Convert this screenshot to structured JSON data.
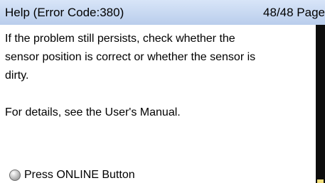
{
  "header": {
    "title": "Help (Error Code:380)",
    "page": "48/48 Page"
  },
  "help": {
    "message": "If the problem still persists, check whether the\nsensor position is correct or whether the sensor is\ndirty.\n\nFor details, see the User's Manual."
  },
  "online_button": {
    "icon": "online-indicator-icon",
    "label": "Press ONLINE Button"
  },
  "colors": {
    "header_background": "#c8d8f2",
    "scrollbar": "#0d0d0d",
    "scroll_thumb": "#f2df7a"
  }
}
